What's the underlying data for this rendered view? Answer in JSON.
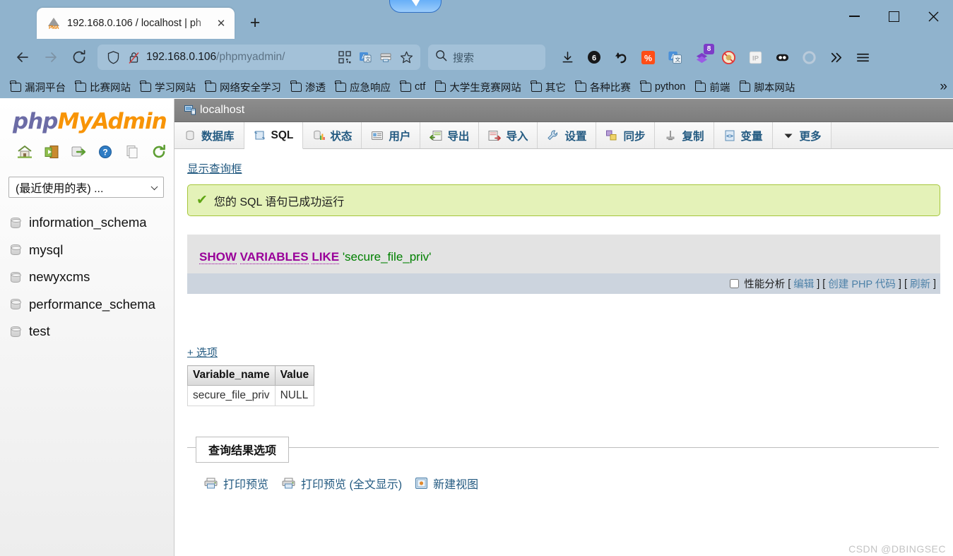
{
  "browser": {
    "tab": {
      "title": "192.168.0.106 / localhost | ph",
      "favicon_name": "phpmyadmin-favicon",
      "favicon_text": "PMA",
      "close_label": "✕"
    },
    "new_tab_label": "+",
    "window_controls": {
      "minimize": "—",
      "maximize": "□",
      "close": "✕"
    },
    "nav": {
      "back_label": "←",
      "forward_label": "→",
      "reload_label": "↻",
      "url_host": "192.168.0.106",
      "url_path": "/phpmyadmin/",
      "shield_name": "tracking-shield-icon",
      "lock_name": "insecure-lock-icon",
      "qr_name": "qrcode-icon",
      "translate_name": "translate-icon",
      "reader_name": "save-page-icon",
      "bookmark_star_name": "bookmark-star-icon"
    },
    "search": {
      "placeholder": "搜索"
    },
    "extensions": [
      {
        "name": "downloads-icon",
        "glyph": "↓",
        "badge": ""
      },
      {
        "name": "counter-badge-icon",
        "glyph": "6",
        "badge": ""
      },
      {
        "name": "undo-arrow-icon",
        "glyph": "↩",
        "badge": ""
      },
      {
        "name": "percent-orange-icon",
        "glyph": "%",
        "badge": ""
      },
      {
        "name": "translate-ext-icon",
        "glyph": "A",
        "badge": ""
      },
      {
        "name": "purple-layers-icon",
        "glyph": "",
        "badge": "8"
      },
      {
        "name": "block-adblock-icon",
        "glyph": "",
        "badge": ""
      },
      {
        "name": "ip-address-icon",
        "glyph": "IP",
        "badge": ""
      },
      {
        "name": "eyes-ext-icon",
        "glyph": "",
        "badge": ""
      },
      {
        "name": "circle-ext-icon",
        "glyph": "",
        "badge": ""
      }
    ],
    "overflow_label": "»",
    "menu_label": "☰",
    "bookmarks": [
      "漏洞平台",
      "比赛网站",
      "学习网站",
      "网络安全学习",
      "渗透",
      "应急响应",
      "ctf",
      "大学生竞赛网站",
      "其它",
      "各种比赛",
      "python",
      "前端",
      "脚本网站"
    ],
    "bookmarks_overflow": "»"
  },
  "sidebar": {
    "logo_part1": "php",
    "logo_part2": "MyAdmin",
    "icons": [
      {
        "name": "home-icon"
      },
      {
        "name": "logout-icon"
      },
      {
        "name": "query-window-icon"
      },
      {
        "name": "help-icon"
      },
      {
        "name": "docs-icon"
      },
      {
        "name": "reload-navigation-icon"
      }
    ],
    "recent_tables_label": "(最近使用的表) ...",
    "databases": [
      "information_schema",
      "mysql",
      "newyxcms",
      "performance_schema",
      "test"
    ]
  },
  "main": {
    "server_label": "localhost",
    "server_icon_name": "server-icon",
    "tabs": [
      {
        "label": "数据库",
        "icon": "database-icon",
        "active": false
      },
      {
        "label": "SQL",
        "icon": "sql-scroll-icon",
        "active": true
      },
      {
        "label": "状态",
        "icon": "status-chart-icon",
        "active": false
      },
      {
        "label": "用户",
        "icon": "users-icon",
        "active": false
      },
      {
        "label": "导出",
        "icon": "export-icon",
        "active": false
      },
      {
        "label": "导入",
        "icon": "import-icon",
        "active": false
      },
      {
        "label": "设置",
        "icon": "settings-wrench-icon",
        "active": false
      },
      {
        "label": "同步",
        "icon": "sync-icon",
        "active": false
      },
      {
        "label": "复制",
        "icon": "replication-icon",
        "active": false
      },
      {
        "label": "变量",
        "icon": "variables-icon",
        "active": false
      },
      {
        "label": "更多",
        "icon": "chevron-down-icon",
        "active": false
      }
    ],
    "show_query_box_link": "显示查询框",
    "success_message": "您的 SQL 语句已成功运行",
    "success_check": "✔",
    "query": {
      "keyword1": "SHOW",
      "keyword2": "VARIABLES",
      "keyword3": "LIKE",
      "literal": "'secure_file_priv'"
    },
    "query_footer": {
      "profiling_label": "性能分析",
      "edit_label": "编辑",
      "create_php_label": "创建 PHP 代码",
      "refresh_label": "刷新",
      "bracket_open": "[",
      "bracket_close": "]"
    },
    "options_link": "+ 选项",
    "result_table": {
      "columns": [
        "Variable_name",
        "Value"
      ],
      "rows": [
        [
          "secure_file_priv",
          "NULL"
        ]
      ]
    },
    "results_fieldset": {
      "legend": "查询结果选项",
      "actions": [
        {
          "label": "打印预览",
          "icon": "printer-icon"
        },
        {
          "label": "打印预览 (全文显示)",
          "icon": "printer-icon"
        },
        {
          "label": "新建视图",
          "icon": "new-view-icon"
        }
      ]
    }
  },
  "watermark": "CSDN @DBINGSEC",
  "colors": {
    "chrome_bg": "#90b3cd",
    "urlbar_bg": "#a3c1d8",
    "success_bg": "#e4f2b8",
    "success_border": "#a5c63b",
    "sql_box_bg": "#e3e3e3",
    "sql_foot_bg": "#ccd4de",
    "keyword": "#990099",
    "string_literal": "#008000",
    "link": "#235a81",
    "server_bar_bg": "#7d7d7d"
  }
}
